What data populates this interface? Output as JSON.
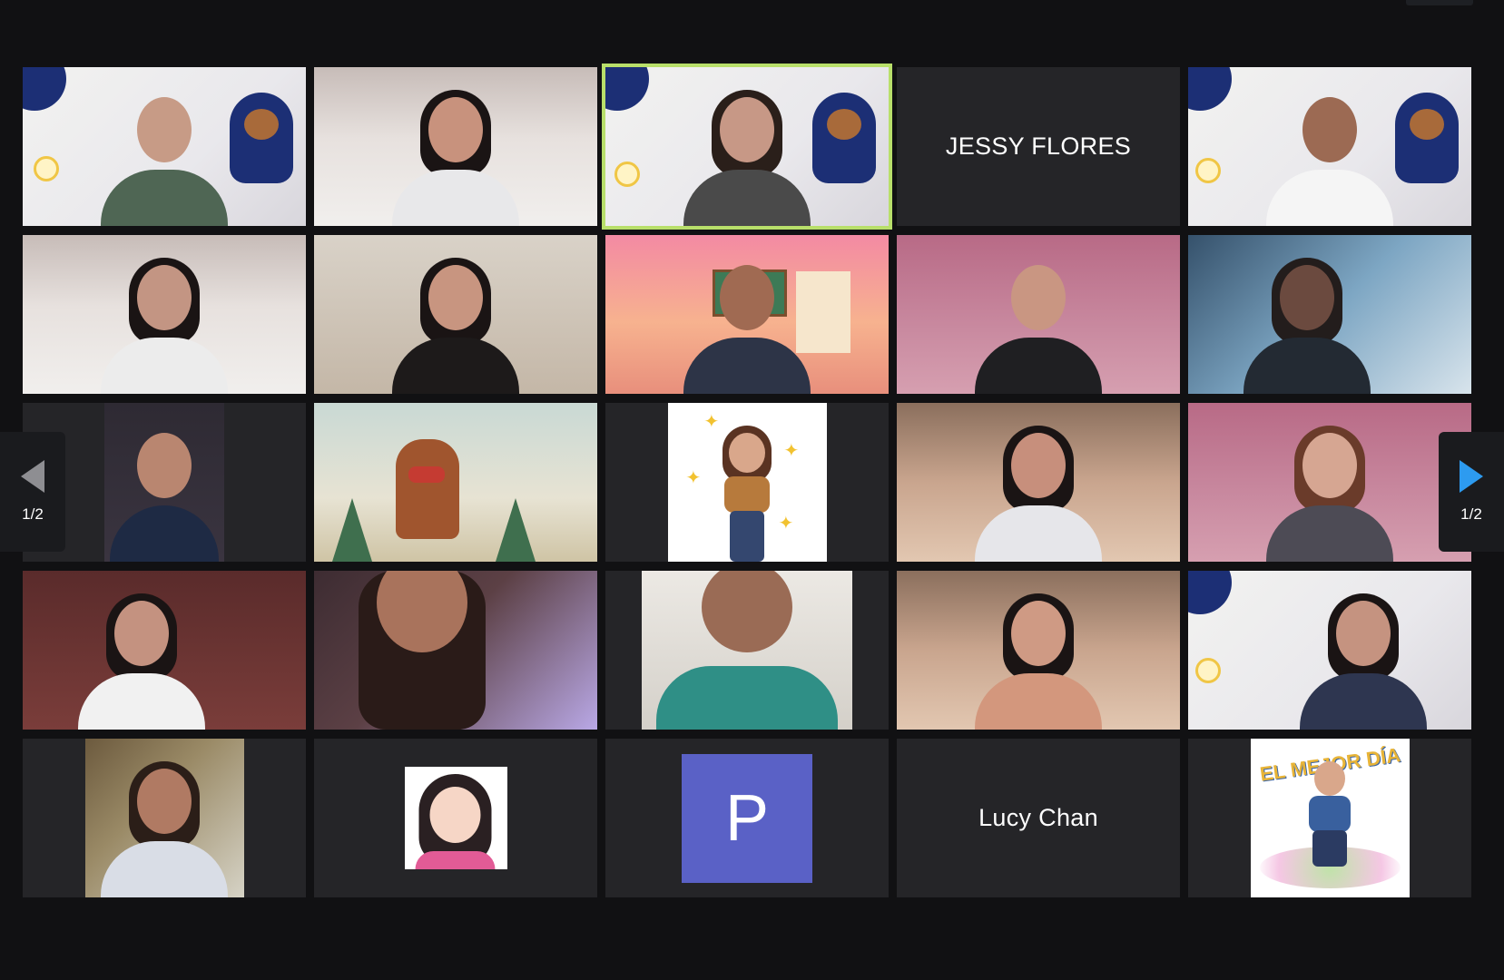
{
  "meeting": {
    "page_indicator": "1/2",
    "accent_active_border": "#b8df6a",
    "avatar_p_color": "#5a61c6",
    "next_arrow_color": "#2d9bf0"
  },
  "navigation": {
    "prev_label": "1/2",
    "next_label": "1/2"
  },
  "tiles": [
    {
      "kind": "video",
      "icon": "participant-video"
    },
    {
      "kind": "video",
      "icon": "participant-video"
    },
    {
      "kind": "video",
      "icon": "participant-video",
      "active": true
    },
    {
      "kind": "name",
      "name": "JESSY FLORES"
    },
    {
      "kind": "video",
      "icon": "participant-video"
    },
    {
      "kind": "video",
      "icon": "participant-video"
    },
    {
      "kind": "video",
      "icon": "participant-video"
    },
    {
      "kind": "video",
      "icon": "participant-video"
    },
    {
      "kind": "video",
      "icon": "participant-video"
    },
    {
      "kind": "video",
      "icon": "participant-video"
    },
    {
      "kind": "video",
      "icon": "participant-video"
    },
    {
      "kind": "image",
      "icon": "deer-picture"
    },
    {
      "kind": "image",
      "icon": "cartoon-avatar"
    },
    {
      "kind": "video",
      "icon": "participant-video"
    },
    {
      "kind": "video",
      "icon": "participant-video"
    },
    {
      "kind": "video",
      "icon": "participant-video"
    },
    {
      "kind": "video",
      "icon": "participant-video"
    },
    {
      "kind": "video",
      "icon": "participant-video"
    },
    {
      "kind": "video",
      "icon": "participant-video"
    },
    {
      "kind": "video",
      "icon": "participant-video"
    },
    {
      "kind": "image",
      "icon": "profile-photo"
    },
    {
      "kind": "image",
      "icon": "cartoon-avatar"
    },
    {
      "kind": "initial",
      "initial": "P"
    },
    {
      "kind": "name",
      "name": "Lucy Chan"
    },
    {
      "kind": "image",
      "icon": "cartoon-avatar",
      "caption": "EL MEJOR DÍA"
    }
  ]
}
